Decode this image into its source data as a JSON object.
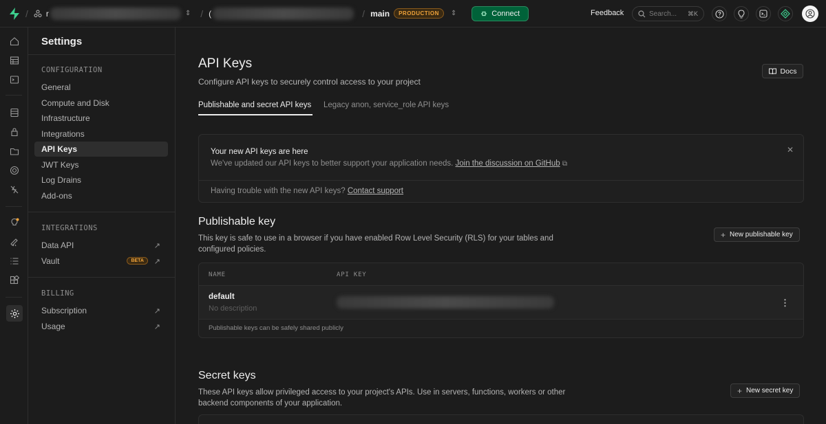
{
  "topbar": {
    "org_initial": "r",
    "project_initial": "(",
    "branch": "main",
    "env_badge": "PRODUCTION",
    "connect_label": "Connect",
    "feedback_label": "Feedback",
    "search_placeholder": "Search...",
    "search_shortcut": "⌘K",
    "accent": "#3ecf8e"
  },
  "sidebar": {
    "title": "Settings",
    "configuration_heading": "CONFIGURATION",
    "configuration_items": [
      "General",
      "Compute and Disk",
      "Infrastructure",
      "Integrations",
      "API Keys",
      "JWT Keys",
      "Log Drains",
      "Add-ons"
    ],
    "integrations_heading": "INTEGRATIONS",
    "integrations_items": [
      "Data API",
      "Vault"
    ],
    "vault_badge": "BETA",
    "billing_heading": "BILLING",
    "billing_items": [
      "Subscription",
      "Usage"
    ]
  },
  "main": {
    "title": "API Keys",
    "subtitle": "Configure API keys to securely control access to your project",
    "docs_label": "Docs",
    "tabs": [
      "Publishable and secret API keys",
      "Legacy anon, service_role API keys"
    ],
    "notice": {
      "title": "Your new API keys are here",
      "body": "We've updated our API keys to better support your application needs.",
      "body_link": "Join the discussion on GitHub",
      "footer": "Having trouble with the new API keys?",
      "footer_link": "Contact support"
    },
    "publishable": {
      "title": "Publishable key",
      "description": "This key is safe to use in a browser if you have enabled Row Level Security (RLS) for your tables and configured policies.",
      "new_button": "New publishable key",
      "columns": [
        "NAME",
        "API KEY"
      ],
      "row": {
        "name": "default",
        "description": "No description"
      },
      "footer": "Publishable keys can be safely shared publicly"
    },
    "secret": {
      "title": "Secret keys",
      "description": "These API keys allow privileged access to your project's APIs. Use in servers, functions, workers or other backend components of your application.",
      "new_button": "New secret key"
    }
  }
}
